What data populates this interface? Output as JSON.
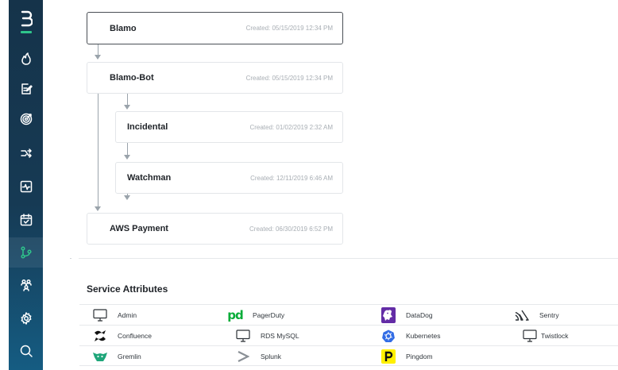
{
  "sidebar": {
    "items": [
      {
        "name": "logo",
        "icon": "bold-b-logo-icon"
      },
      {
        "name": "incidents",
        "icon": "flame-icon"
      },
      {
        "name": "notes",
        "icon": "edit-document-icon"
      },
      {
        "name": "targets",
        "icon": "target-icon"
      },
      {
        "name": "workflows",
        "icon": "shuffle-icon"
      },
      {
        "name": "monitoring",
        "icon": "pulse-icon"
      },
      {
        "name": "calendar",
        "icon": "calendar-check-icon"
      },
      {
        "name": "services",
        "icon": "git-branch-icon",
        "active": true
      },
      {
        "name": "teams",
        "icon": "people-icon"
      },
      {
        "name": "settings",
        "icon": "gear-icon"
      },
      {
        "name": "search",
        "icon": "search-icon"
      }
    ],
    "accent": "#2fc58b"
  },
  "tree": {
    "nodes": [
      {
        "name": "Blamo",
        "created": "Created: 05/15/2019 12:34 PM",
        "selected": true
      },
      {
        "name": "Blamo-Bot",
        "created": "Created: 05/15/2019 12:34 PM"
      },
      {
        "name": "Incidental",
        "created": "Created: 01/02/2019 2:32 AM"
      },
      {
        "name": "Watchman",
        "created": "Created: 12/11/2019 6:46 AM"
      },
      {
        "name": "AWS Payment",
        "created": "Created: 06/30/2019 6:52 PM"
      }
    ]
  },
  "attributes": {
    "title": "Service Attributes",
    "rows": [
      [
        {
          "label": "Admin",
          "icon": "monitor-icon"
        },
        {
          "label": "PagerDuty",
          "icon": "pagerduty-logo-icon"
        },
        {
          "label": "DataDog",
          "icon": "datadog-logo-icon"
        },
        {
          "label": "Sentry",
          "icon": "sentry-logo-icon"
        }
      ],
      [
        {
          "label": "Confluence",
          "icon": "confluence-logo-icon"
        },
        {
          "label": "RDS MySQL",
          "icon": "monitor-icon"
        },
        {
          "label": "Kubernetes",
          "icon": "kubernetes-logo-icon"
        },
        {
          "label": "Twistlock",
          "icon": "monitor-icon"
        }
      ],
      [
        {
          "label": "Gremlin",
          "icon": "gremlin-logo-icon"
        },
        {
          "label": "Splunk",
          "icon": "splunk-logo-icon"
        },
        {
          "label": "Pingdom",
          "icon": "pingdom-logo-icon"
        }
      ]
    ],
    "colors": {
      "pagerduty": "#06ac38",
      "datadog": "#632ca6",
      "kubernetes": "#326ce5",
      "pingdom": "#fff000",
      "gremlin": "#1fa67a"
    }
  }
}
